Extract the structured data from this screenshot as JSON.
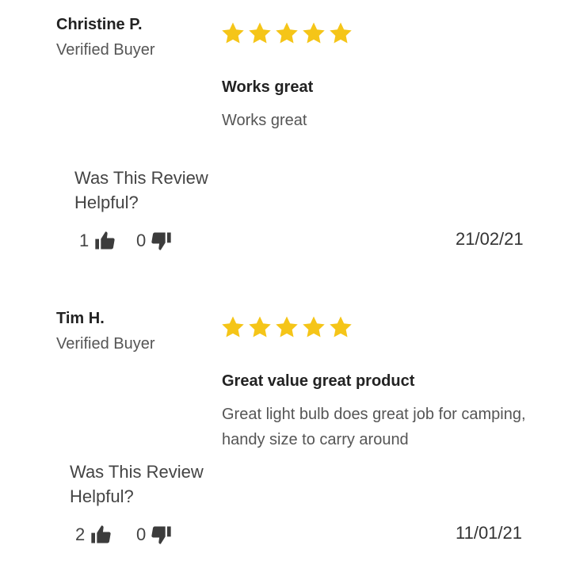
{
  "reviews": [
    {
      "reviewer_name": "Christine P.",
      "badge": "Verified Buyer",
      "rating": 5,
      "title": "Works great",
      "body": "Works great",
      "helpful_label": "Was This Review Helpful?",
      "helpful_count": "1",
      "unhelpful_count": "0",
      "date": "21/02/21"
    },
    {
      "reviewer_name": "Tim H.",
      "badge": "Verified Buyer",
      "rating": 5,
      "title": "Great value great product",
      "body": "Great light bulb does great job for camping, handy size to carry around",
      "helpful_label": "Was This Review Helpful?",
      "helpful_count": "2",
      "unhelpful_count": "0",
      "date": "11/01/21"
    }
  ],
  "icons": {
    "star": "star-icon",
    "thumbs_up": "thumbs-up-icon",
    "thumbs_down": "thumbs-down-icon"
  },
  "colors": {
    "star": "#F5C518",
    "thumb": "#3C3C3C"
  }
}
